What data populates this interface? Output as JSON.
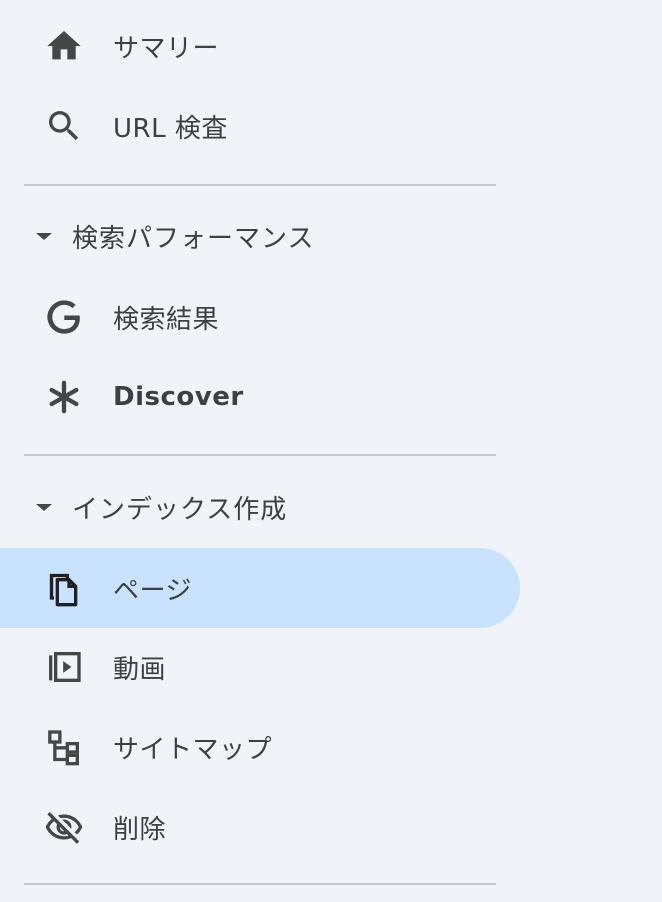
{
  "nav": {
    "summary": {
      "label": "サマリー",
      "icon": "home-icon"
    },
    "url_inspection": {
      "label": "URL 検査",
      "icon": "search-icon"
    },
    "performance_section": {
      "label": "検索パフォーマンス",
      "icon": "caret-down-icon"
    },
    "search_results": {
      "label": "検索結果",
      "icon": "google-g-icon"
    },
    "discover": {
      "label": "Discover",
      "icon": "asterisk-icon"
    },
    "index_section": {
      "label": "インデックス作成",
      "icon": "caret-down-icon"
    },
    "pages": {
      "label": "ページ",
      "icon": "copy-pages-icon",
      "active": true
    },
    "videos": {
      "label": "動画",
      "icon": "video-library-icon"
    },
    "sitemaps": {
      "label": "サイトマップ",
      "icon": "sitemap-icon"
    },
    "removals": {
      "label": "削除",
      "icon": "eye-off-icon"
    }
  },
  "colors": {
    "background": "#f0f4f9",
    "active_background": "#c9e2fd",
    "text": "#3c4043",
    "icon": "#444746",
    "divider": "#c7c7c7"
  }
}
